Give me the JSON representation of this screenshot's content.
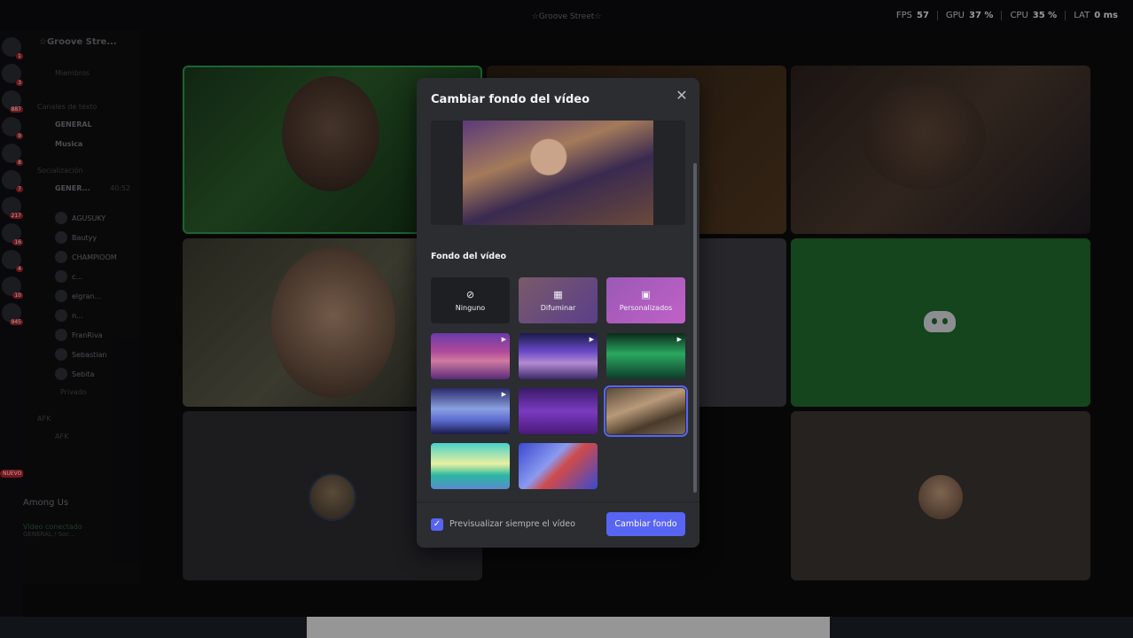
{
  "window": {
    "title": "☆Groove Street☆",
    "perf": [
      {
        "label": "FPS",
        "value": "57"
      },
      {
        "label": "GPU",
        "value": "37 %"
      },
      {
        "label": "CPU",
        "value": "35 %"
      },
      {
        "label": "LAT",
        "value": "0 ms"
      }
    ]
  },
  "servers": {
    "badges": [
      "1",
      "3",
      "887",
      "9",
      "8",
      "7",
      "217",
      "16",
      "4",
      "10",
      "945"
    ],
    "new_label": "NUEVO"
  },
  "sidebar": {
    "server_name": "☆Groove Stre...",
    "members_label": "Miembros",
    "text_category": "Canales de texto",
    "text_channels": [
      "GENERAL",
      "Musica"
    ],
    "social_category": "Socialización",
    "voice_channel": "GENER...",
    "voice_timer": "40:52",
    "voice_users": [
      "AGUSUKY",
      "Bautyy",
      "CHAMPIOOM",
      "c...",
      "elgran...",
      "n...",
      "FranRiva",
      "Sebastian",
      "Sebita"
    ],
    "private_channel": "Privado",
    "afk_category": "AFK",
    "afk_channel": "AFK",
    "activity": "Among Us",
    "voice_status": "Video conectado",
    "voice_sub": "GENERAL / Soc..."
  },
  "modal": {
    "title": "Cambiar fondo del vídeo",
    "section_label": "Fondo del vídeo",
    "options": [
      {
        "label": "Ninguno",
        "icon": "none-icon"
      },
      {
        "label": "Difuminar",
        "icon": "blur-icon"
      },
      {
        "label": "Personalizados",
        "icon": "image-icon"
      }
    ],
    "preview_checkbox_label": "Previsualizar siempre el vídeo",
    "preview_checked": true,
    "apply_button": "Cambiar fondo",
    "accent": "#5865f2"
  }
}
